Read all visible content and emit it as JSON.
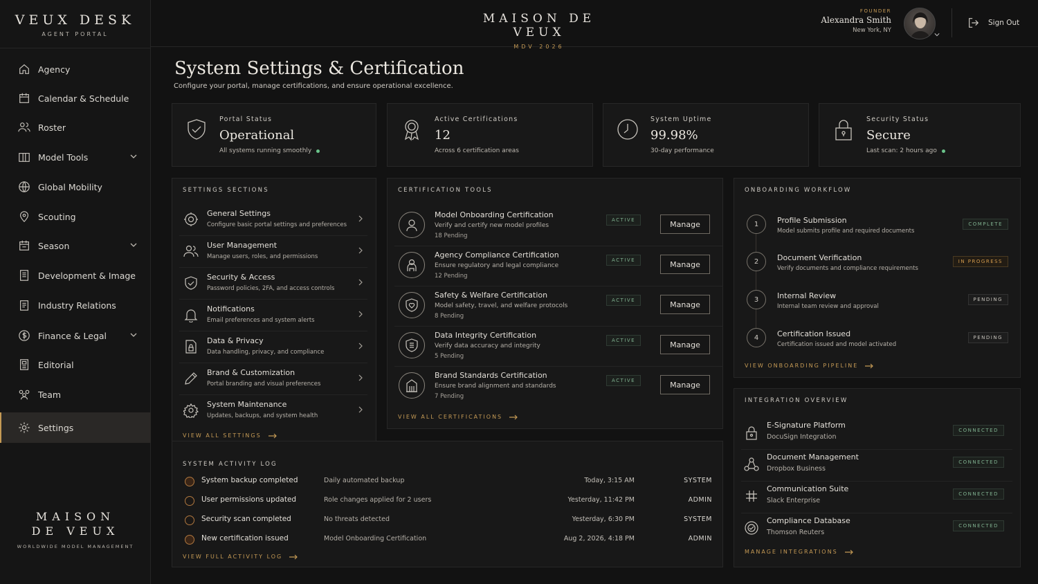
{
  "sidebar": {
    "brand_title": "VEUX DESK",
    "brand_subtitle": "AGENT PORTAL",
    "items": [
      {
        "label": "Agency"
      },
      {
        "label": "Calendar & Schedule"
      },
      {
        "label": "Roster"
      },
      {
        "label": "Model Tools"
      },
      {
        "label": "Global Mobility"
      },
      {
        "label": "Scouting"
      },
      {
        "label": "Season"
      },
      {
        "label": "Development & Image"
      },
      {
        "label": "Industry Relations"
      },
      {
        "label": "Finance & Legal"
      },
      {
        "label": "Editorial"
      },
      {
        "label": "Team"
      },
      {
        "label": "Settings"
      }
    ],
    "footer_line1": "MAISON",
    "footer_line2": "DE VEUX",
    "footer_tagline": "WORLDWIDE MODEL MANAGEMENT"
  },
  "header": {
    "logo_title": "MAISON DE VEUX",
    "logo_subtitle": "MDV 2026",
    "user_role": "FOUNDER",
    "user_name": "Alexandra Smith",
    "user_location": "New York, NY",
    "sign_out": "Sign Out"
  },
  "page": {
    "title": "System Settings & Certification",
    "subtitle": "Configure your portal, manage certifications, and ensure operational excellence."
  },
  "stats": [
    {
      "label": "Portal Status",
      "value": "Operational",
      "sub": "All systems running smoothly",
      "icon": "shield-check-icon"
    },
    {
      "label": "Active Certifications",
      "value": "12",
      "sub": "Across 6 certification areas",
      "icon": "award-icon"
    },
    {
      "label": "System Uptime",
      "value": "99.98%",
      "sub": "30-day performance",
      "icon": "clock-icon"
    },
    {
      "label": "Security Status",
      "value": "Secure",
      "sub": "Last scan: 2 hours ago",
      "icon": "lock-icon"
    }
  ],
  "settings": {
    "title": "SETTINGS SECTIONS",
    "items": [
      {
        "title": "General Settings",
        "desc": "Configure basic portal settings and preferences"
      },
      {
        "title": "User Management",
        "desc": "Manage users, roles, and permissions"
      },
      {
        "title": "Security & Access",
        "desc": "Password policies, 2FA, and access controls"
      },
      {
        "title": "Notifications",
        "desc": "Email preferences and system alerts"
      },
      {
        "title": "Data & Privacy",
        "desc": "Data handling, privacy, and compliance"
      },
      {
        "title": "Brand & Customization",
        "desc": "Portal branding and visual preferences"
      },
      {
        "title": "System Maintenance",
        "desc": "Updates, backups, and system health"
      }
    ],
    "link": "VIEW ALL SETTINGS"
  },
  "certifications": {
    "title": "CERTIFICATION TOOLS",
    "items": [
      {
        "title": "Model Onboarding Certification",
        "desc": "Verify and certify new model profiles",
        "pending": "18 Pending",
        "status": "ACTIVE",
        "action": "Manage"
      },
      {
        "title": "Agency Compliance Certification",
        "desc": "Ensure regulatory and legal compliance",
        "pending": "12 Pending",
        "status": "ACTIVE",
        "action": "Manage"
      },
      {
        "title": "Safety & Welfare Certification",
        "desc": "Model safety, travel, and welfare protocols",
        "pending": "8 Pending",
        "status": "ACTIVE",
        "action": "Manage"
      },
      {
        "title": "Data Integrity Certification",
        "desc": "Verify data accuracy and integrity",
        "pending": "5 Pending",
        "status": "ACTIVE",
        "action": "Manage"
      },
      {
        "title": "Brand Standards Certification",
        "desc": "Ensure brand alignment and standards",
        "pending": "7 Pending",
        "status": "ACTIVE",
        "action": "Manage"
      }
    ],
    "link": "VIEW ALL CERTIFICATIONS"
  },
  "onboarding": {
    "title": "ONBOARDING WORKFLOW",
    "steps": [
      {
        "num": "1",
        "title": "Profile Submission",
        "desc": "Model submits profile and required documents",
        "status": "COMPLETE"
      },
      {
        "num": "2",
        "title": "Document Verification",
        "desc": "Verify documents and compliance requirements",
        "status": "IN PROGRESS"
      },
      {
        "num": "3",
        "title": "Internal Review",
        "desc": "Internal team review and approval",
        "status": "PENDING"
      },
      {
        "num": "4",
        "title": "Certification Issued",
        "desc": "Certification issued and model activated",
        "status": "PENDING"
      }
    ],
    "link": "VIEW ONBOARDING PIPELINE"
  },
  "integrations": {
    "title": "INTEGRATION OVERVIEW",
    "items": [
      {
        "title": "E-Signature Platform",
        "desc": "DocuSign Integration",
        "status": "CONNECTED"
      },
      {
        "title": "Document Management",
        "desc": "Dropbox Business",
        "status": "CONNECTED"
      },
      {
        "title": "Communication Suite",
        "desc": "Slack Enterprise",
        "status": "CONNECTED"
      },
      {
        "title": "Compliance Database",
        "desc": "Thomson Reuters",
        "status": "CONNECTED"
      }
    ],
    "link": "MANAGE INTEGRATIONS"
  },
  "activity": {
    "title": "SYSTEM ACTIVITY LOG",
    "rows": [
      {
        "event": "System backup completed",
        "detail": "Daily automated backup",
        "time": "Today, 3:15 AM",
        "actor": "SYSTEM"
      },
      {
        "event": "User permissions updated",
        "detail": "Role changes applied for 2 users",
        "time": "Yesterday, 11:42 PM",
        "actor": "ADMIN"
      },
      {
        "event": "Security scan completed",
        "detail": "No threats detected",
        "time": "Yesterday, 6:30 PM",
        "actor": "SYSTEM"
      },
      {
        "event": "New certification issued",
        "detail": "Model Onboarding Certification",
        "time": "Aug 2, 2026, 4:18 PM",
        "actor": "ADMIN"
      }
    ],
    "link": "VIEW FULL ACTIVITY LOG"
  },
  "colors": {
    "accent": "#c59a55",
    "background": "#121212",
    "card": "#181818",
    "success": "#6ac38a"
  }
}
